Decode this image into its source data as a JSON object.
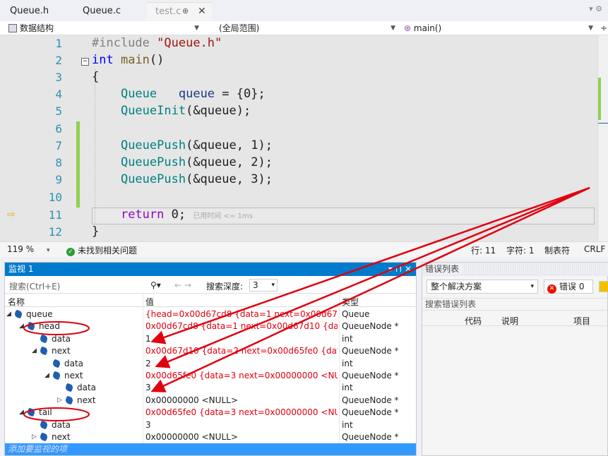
{
  "tabs": [
    {
      "label": "Queue.h"
    },
    {
      "label": "Queue.c"
    },
    {
      "label": "test.c"
    }
  ],
  "tab_pin": "⊕",
  "tab_close": "✕",
  "navbar": {
    "project": "数据结构",
    "scope": "(全局范围)",
    "function": "main()"
  },
  "editor": {
    "lines": [
      {
        "num": "1"
      },
      {
        "num": "2"
      },
      {
        "num": "3"
      },
      {
        "num": "4"
      },
      {
        "num": "5"
      },
      {
        "num": "6"
      },
      {
        "num": "7"
      },
      {
        "num": "8"
      },
      {
        "num": "9"
      },
      {
        "num": "10"
      },
      {
        "num": "11"
      },
      {
        "num": "12"
      }
    ],
    "code": {
      "l1_directive": "#include",
      "l1_file": "\"Queue.h\"",
      "l2_kw": "int",
      "l2_fn": "main",
      "l2_rest": "()",
      "l3": "{",
      "l4_type": "Queue",
      "l4_var": "queue",
      "l4_eq": " = {",
      "l4_num": "0",
      "l4_end": "};",
      "l5_fn": "QueueInit",
      "l5_args": "(&queue);",
      "l7_fn": "QueuePush",
      "l7_args1": "(&queue, ",
      "l7_num": "1",
      "l7_end": ");",
      "l8_fn": "QueuePush",
      "l8_args1": "(&queue, ",
      "l8_num": "2",
      "l8_end": ");",
      "l9_fn": "QueuePush",
      "l9_args1": "(&queue, ",
      "l9_num": "3",
      "l9_end": ");",
      "l11_kw": "return",
      "l11_num": "0",
      "l11_end": ";",
      "l11_hint": "已用时间 <= 1ms",
      "l12": "}"
    }
  },
  "status": {
    "zoom": "119 %",
    "issues": "未找到相关问题",
    "line": "行: 11",
    "char": "字符: 1",
    "tabs": "制表符",
    "eol": "CRLF"
  },
  "watch": {
    "title": "监视 1",
    "title_buttons": "▾ ⊓ ✕",
    "search_placeholder": "搜索(Ctrl+E)",
    "search_icon": "search-icon",
    "nav_arrows": "← →",
    "depth_label": "搜索深度:",
    "depth_value": "3",
    "headers": {
      "name": "名称",
      "value": "值",
      "type": "类型"
    },
    "rows": [
      {
        "name": "queue",
        "value": "{head=0x00d67cd8 {data=1 next=0x00d67d10 {...",
        "type": "Queue",
        "red": true
      },
      {
        "name": "head",
        "value": "0x00d67cd8 {data=1 next=0x00d67d10 {data=2 ...",
        "type": "QueueNode *",
        "red": true
      },
      {
        "name": "data",
        "value": "1",
        "type": "int",
        "red": false
      },
      {
        "name": "next",
        "value": "0x00d67d10 {data=2 next=0x00d65fe0 {data=3 ...",
        "type": "QueueNode *",
        "red": true
      },
      {
        "name": "data",
        "value": "2",
        "type": "int",
        "red": false
      },
      {
        "name": "next",
        "value": "0x00d65fe0 {data=3 next=0x00000000 <NULL> }",
        "type": "QueueNode *",
        "red": true
      },
      {
        "name": "data",
        "value": "3",
        "type": "int",
        "red": false
      },
      {
        "name": "next",
        "value": "0x00000000 <NULL>",
        "type": "QueueNode *",
        "red": false
      },
      {
        "name": "tail",
        "value": "0x00d65fe0 {data=3 next=0x00000000 <NULL> }",
        "type": "QueueNode *",
        "red": true
      },
      {
        "name": "data",
        "value": "3",
        "type": "int",
        "red": false
      },
      {
        "name": "next",
        "value": "0x00000000 <NULL>",
        "type": "QueueNode *",
        "red": false
      }
    ],
    "add_item": "添加要监视的项"
  },
  "errors": {
    "title": "错误列表",
    "scope": "整个解决方案",
    "error_count": "错误 0",
    "search_placeholder": "搜索错误列表",
    "headers": {
      "code": "代码",
      "desc": "说明",
      "project": "项目"
    }
  },
  "colors": {
    "accent": "#007acc",
    "annotation": "#e0000f",
    "change_bar": "#8fd14f",
    "selection": "#3399ff"
  }
}
